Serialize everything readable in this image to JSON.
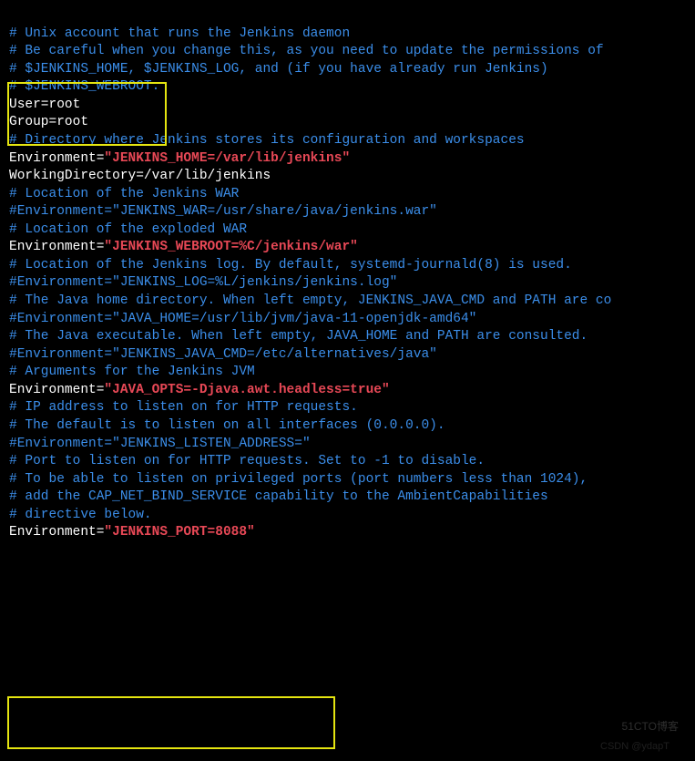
{
  "lines": [
    {
      "segments": [
        {
          "cls": "white",
          "text": " "
        }
      ]
    },
    {
      "segments": [
        {
          "cls": "comment",
          "text": "# Unix account that runs the Jenkins daemon"
        }
      ]
    },
    {
      "segments": [
        {
          "cls": "comment",
          "text": "# Be careful when you change this, as you need to update the permissions of"
        }
      ]
    },
    {
      "segments": [
        {
          "cls": "comment",
          "text": "# $JENKINS_HOME, $JENKINS_LOG, and (if you have already run Jenkins)"
        }
      ]
    },
    {
      "segments": [
        {
          "cls": "comment",
          "text": "# $JENKINS_WEBROOT."
        }
      ]
    },
    {
      "segments": [
        {
          "cls": "white",
          "text": "User=root"
        }
      ]
    },
    {
      "segments": [
        {
          "cls": "white",
          "text": "Group=root"
        }
      ]
    },
    {
      "segments": [
        {
          "cls": "white",
          "text": ""
        }
      ]
    },
    {
      "segments": [
        {
          "cls": "comment",
          "text": "# Directory where Jenkins stores its configuration and workspaces"
        }
      ]
    },
    {
      "segments": [
        {
          "cls": "white",
          "text": "Environment="
        },
        {
          "cls": "red",
          "text": "\"JENKINS_HOME=/var/lib/jenkins\""
        }
      ]
    },
    {
      "segments": [
        {
          "cls": "white",
          "text": "WorkingDirectory=/var/lib/jenkins"
        }
      ]
    },
    {
      "segments": [
        {
          "cls": "white",
          "text": ""
        }
      ]
    },
    {
      "segments": [
        {
          "cls": "comment",
          "text": "# Location of the Jenkins WAR"
        }
      ]
    },
    {
      "segments": [
        {
          "cls": "comment",
          "text": "#Environment=\"JENKINS_WAR=/usr/share/java/jenkins.war\""
        }
      ]
    },
    {
      "segments": [
        {
          "cls": "white",
          "text": ""
        }
      ]
    },
    {
      "segments": [
        {
          "cls": "comment",
          "text": "# Location of the exploded WAR"
        }
      ]
    },
    {
      "segments": [
        {
          "cls": "white",
          "text": "Environment="
        },
        {
          "cls": "red",
          "text": "\"JENKINS_WEBROOT=%C/jenkins/war\""
        }
      ]
    },
    {
      "segments": [
        {
          "cls": "white",
          "text": ""
        }
      ]
    },
    {
      "segments": [
        {
          "cls": "comment",
          "text": "# Location of the Jenkins log. By default, systemd-journald(8) is used."
        }
      ]
    },
    {
      "segments": [
        {
          "cls": "comment",
          "text": "#Environment=\"JENKINS_LOG=%L/jenkins/jenkins.log\""
        }
      ]
    },
    {
      "segments": [
        {
          "cls": "white",
          "text": ""
        }
      ]
    },
    {
      "segments": [
        {
          "cls": "comment",
          "text": "# The Java home directory. When left empty, JENKINS_JAVA_CMD and PATH are co"
        }
      ]
    },
    {
      "segments": [
        {
          "cls": "comment",
          "text": "#Environment=\"JAVA_HOME=/usr/lib/jvm/java-11-openjdk-amd64\""
        }
      ]
    },
    {
      "segments": [
        {
          "cls": "white",
          "text": ""
        }
      ]
    },
    {
      "segments": [
        {
          "cls": "comment",
          "text": "# The Java executable. When left empty, JAVA_HOME and PATH are consulted."
        }
      ]
    },
    {
      "segments": [
        {
          "cls": "comment",
          "text": "#Environment=\"JENKINS_JAVA_CMD=/etc/alternatives/java\""
        }
      ]
    },
    {
      "segments": [
        {
          "cls": "white",
          "text": ""
        }
      ]
    },
    {
      "segments": [
        {
          "cls": "comment",
          "text": "# Arguments for the Jenkins JVM"
        }
      ]
    },
    {
      "segments": [
        {
          "cls": "white",
          "text": "Environment="
        },
        {
          "cls": "red",
          "text": "\"JAVA_OPTS=-Djava.awt.headless=true\""
        }
      ]
    },
    {
      "segments": [
        {
          "cls": "white",
          "text": ""
        }
      ]
    },
    {
      "segments": [
        {
          "cls": "comment",
          "text": "# IP address to listen on for HTTP requests."
        }
      ]
    },
    {
      "segments": [
        {
          "cls": "comment",
          "text": "# The default is to listen on all interfaces (0.0.0.0)."
        }
      ]
    },
    {
      "segments": [
        {
          "cls": "comment",
          "text": "#Environment=\"JENKINS_LISTEN_ADDRESS=\""
        }
      ]
    },
    {
      "segments": [
        {
          "cls": "white",
          "text": ""
        }
      ]
    },
    {
      "segments": [
        {
          "cls": "comment",
          "text": "# Port to listen on for HTTP requests. Set to -1 to disable."
        }
      ]
    },
    {
      "segments": [
        {
          "cls": "comment",
          "text": "# To be able to listen on privileged ports (port numbers less than 1024),"
        }
      ]
    },
    {
      "segments": [
        {
          "cls": "comment",
          "text": "# add the CAP_NET_BIND_SERVICE capability to the AmbientCapabilities"
        }
      ]
    },
    {
      "segments": [
        {
          "cls": "comment",
          "text": "# directive below."
        }
      ]
    },
    {
      "segments": [
        {
          "cls": "white",
          "text": "Environment="
        },
        {
          "cls": "red",
          "text": "\"JENKINS_PORT=8088\""
        }
      ]
    },
    {
      "segments": [
        {
          "cls": "white",
          "text": ""
        }
      ]
    }
  ],
  "watermark1": "51CTO博客",
  "watermark2": "CSDN @ydapT"
}
